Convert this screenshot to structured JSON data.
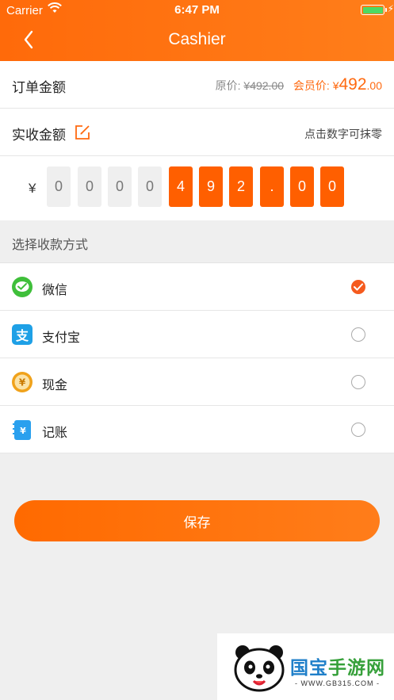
{
  "status_bar": {
    "carrier": "Carrier",
    "time": "6:47 PM"
  },
  "nav": {
    "title": "Cashier"
  },
  "order": {
    "label": "订单金额",
    "original_label": "原价:",
    "original_price": "¥492.00",
    "member_label": "会员价:",
    "member_currency": "¥",
    "member_int": "492",
    "member_dec": ".00"
  },
  "received": {
    "label": "实收金额",
    "hint": "点击数字可抹零"
  },
  "amount": {
    "currency": "¥",
    "digits": [
      "0",
      "0",
      "0",
      "0",
      "4",
      "9",
      "2",
      ".",
      "0",
      "0"
    ]
  },
  "payment": {
    "section_title": "选择收款方式",
    "methods": [
      {
        "label": "微信",
        "icon": "wechat-icon",
        "selected": true
      },
      {
        "label": "支付宝",
        "icon": "alipay-icon",
        "selected": false
      },
      {
        "label": "现金",
        "icon": "cash-icon",
        "selected": false
      },
      {
        "label": "记账",
        "icon": "ledger-icon",
        "selected": false
      }
    ]
  },
  "save_label": "保存",
  "watermark": {
    "name_a": "国宝",
    "name_b": "手游网",
    "url": "- WWW.GB315.COM -"
  },
  "colors": {
    "accent": "#ff6a10",
    "selected_radio": "#f55a1e",
    "wechat": "#3fbf3a",
    "alipay": "#1ea0e6",
    "cash": "#f0a21b"
  }
}
